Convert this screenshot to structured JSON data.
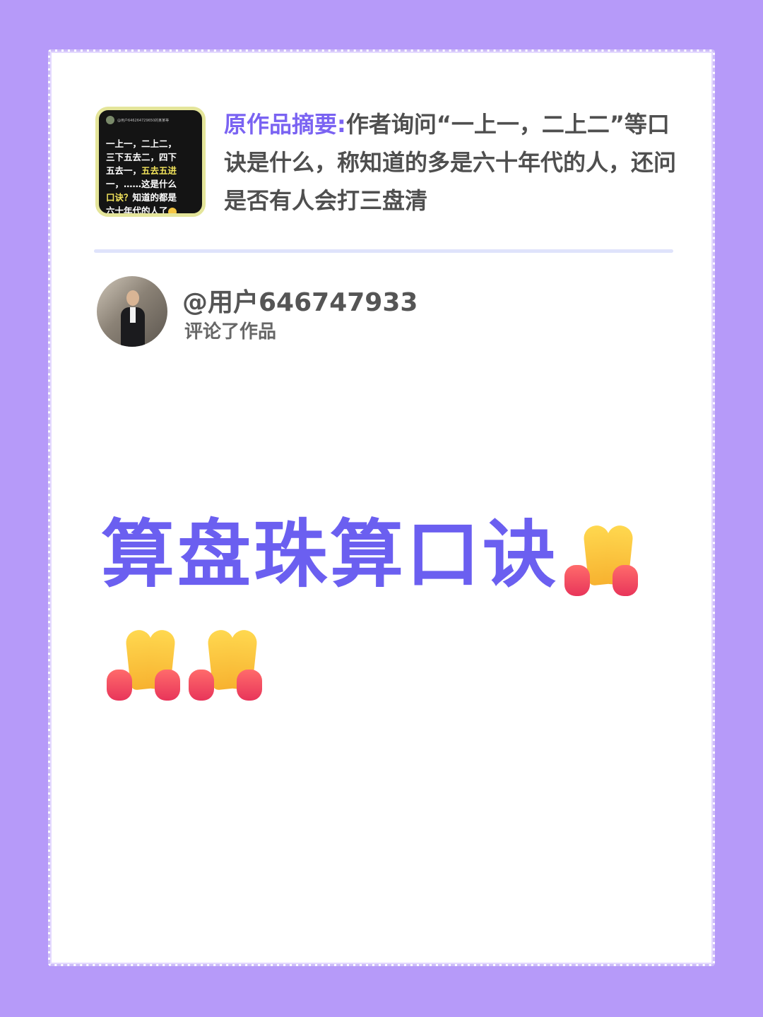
{
  "summary": {
    "label": "原作品摘要:",
    "text": "作者询问“一上一，二上二”等口诀是什么，称知道的多是六十年代的人，还问是否有人会打三盘清",
    "thumbnail": {
      "user": "@用户646264729650的某某等",
      "lines": [
        "一上一，二上二，",
        "三下五去二，四下",
        "五去一，",
        "五去五进",
        "一，……这是什么",
        "口诀？",
        "知道的都是",
        "六十年代的人了"
      ]
    }
  },
  "user": {
    "name": "@用户646747933",
    "action": "评论了作品"
  },
  "comment": {
    "text": "算盘珠算口诀",
    "emoji_icon": "folded-hands-icon",
    "emoji_count": 3
  },
  "colors": {
    "background": "#b69af9",
    "accent": "#7a63f2",
    "comment": "#6b5ff0"
  }
}
